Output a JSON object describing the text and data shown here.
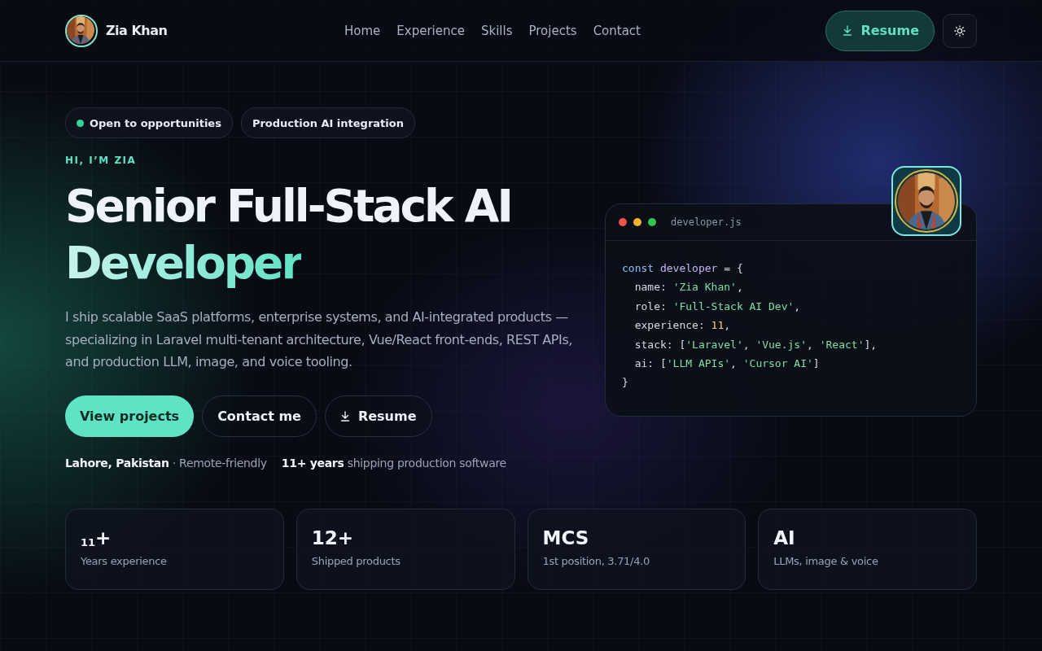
{
  "nav": {
    "brand": "Zia Khan",
    "links": [
      "Home",
      "Experience",
      "Skills",
      "Projects",
      "Contact"
    ],
    "resume_button": "Resume"
  },
  "badges": [
    {
      "label": "Open to opportunities",
      "kind": "status"
    },
    {
      "label": "Production AI integration",
      "kind": "plain"
    }
  ],
  "eyebrow": "HI, I’M ZIA",
  "headline": {
    "line_1": "Senior Full-Stack AI",
    "line_2": "Developer"
  },
  "intro": "I ship scalable SaaS platforms, enterprise systems, and AI-integrated products — specializing in Laravel multi-tenant architecture, Vue/React front-ends, REST APIs, and production LLM, image, and voice tooling.",
  "actions": [
    {
      "label": "View projects",
      "kind": "primary"
    },
    {
      "label": "Contact me",
      "kind": "outline"
    },
    {
      "label": "Resume",
      "kind": "download"
    }
  ],
  "meta": [
    "**Lahore, Pakistan** · Remote-friendly",
    "**11+ years** shipping production software"
  ],
  "code_card": {
    "filename": "developer.js",
    "lines": [
      [
        {
          "text": "const ",
          "kind": "keyword"
        },
        {
          "text": "developer",
          "kind": "variable"
        },
        {
          "text": " = {",
          "kind": "plain"
        }
      ],
      [
        {
          "text": "  name: ",
          "kind": "plain"
        },
        {
          "text": "'Zia Khan'",
          "kind": "string"
        },
        {
          "text": ",",
          "kind": "plain"
        }
      ],
      [
        {
          "text": "  role: ",
          "kind": "plain"
        },
        {
          "text": "'Full-Stack AI Dev'",
          "kind": "string"
        },
        {
          "text": ",",
          "kind": "plain"
        }
      ],
      [
        {
          "text": "  experience: ",
          "kind": "plain"
        },
        {
          "text": "11",
          "kind": "number"
        },
        {
          "text": ",",
          "kind": "plain"
        }
      ],
      [
        {
          "text": "  stack: [",
          "kind": "plain"
        },
        {
          "text": "'Laravel'",
          "kind": "string"
        },
        {
          "text": ", ",
          "kind": "plain"
        },
        {
          "text": "'Vue.js'",
          "kind": "string"
        },
        {
          "text": ", ",
          "kind": "plain"
        },
        {
          "text": "'React'",
          "kind": "string"
        },
        {
          "text": "],",
          "kind": "plain"
        }
      ],
      [
        {
          "text": "  ai: [",
          "kind": "plain"
        },
        {
          "text": "'LLM APIs'",
          "kind": "string"
        },
        {
          "text": ", ",
          "kind": "plain"
        },
        {
          "text": "'Cursor AI'",
          "kind": "string"
        },
        {
          "text": "]",
          "kind": "plain"
        }
      ],
      [
        {
          "text": "}",
          "kind": "plain"
        }
      ]
    ]
  },
  "stats": [
    {
      "value": "$_{11}$+",
      "label": "Years experience"
    },
    {
      "value": "12+",
      "label": "Shipped products"
    },
    {
      "value": "MCS",
      "label": "1st position, 3.71/4.0"
    },
    {
      "value": "AI",
      "label": "LLMs, image & voice"
    }
  ]
}
